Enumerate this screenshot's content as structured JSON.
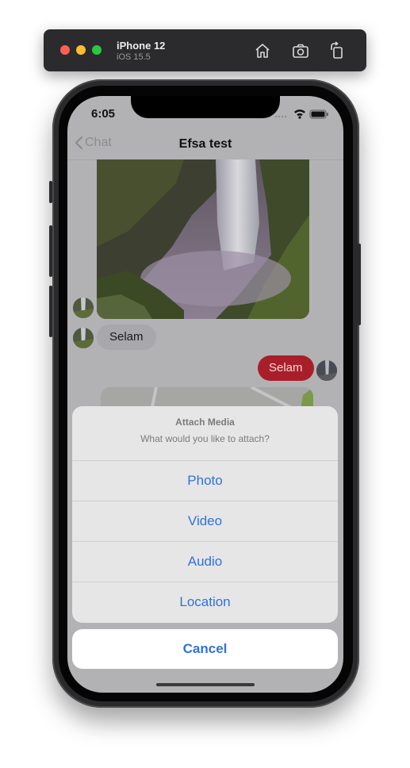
{
  "simulator": {
    "device_name": "iPhone 12",
    "os_version": "iOS 15.5",
    "toolbar_icons": [
      "home-icon",
      "screenshot-icon",
      "rotate-icon"
    ]
  },
  "status_bar": {
    "time": "6:05"
  },
  "nav": {
    "back_label": "Chat",
    "title": "Efsa test"
  },
  "messages": {
    "incoming_text": "Selam",
    "outgoing_text": "Selam"
  },
  "action_sheet": {
    "title": "Attach Media",
    "message": "What would you like to attach?",
    "options": [
      "Photo",
      "Video",
      "Audio",
      "Location"
    ],
    "cancel_label": "Cancel"
  },
  "colors": {
    "accent": "#3172db",
    "outgoing_bubble": "#a81f2a",
    "incoming_bubble": "#a8a8ac"
  }
}
